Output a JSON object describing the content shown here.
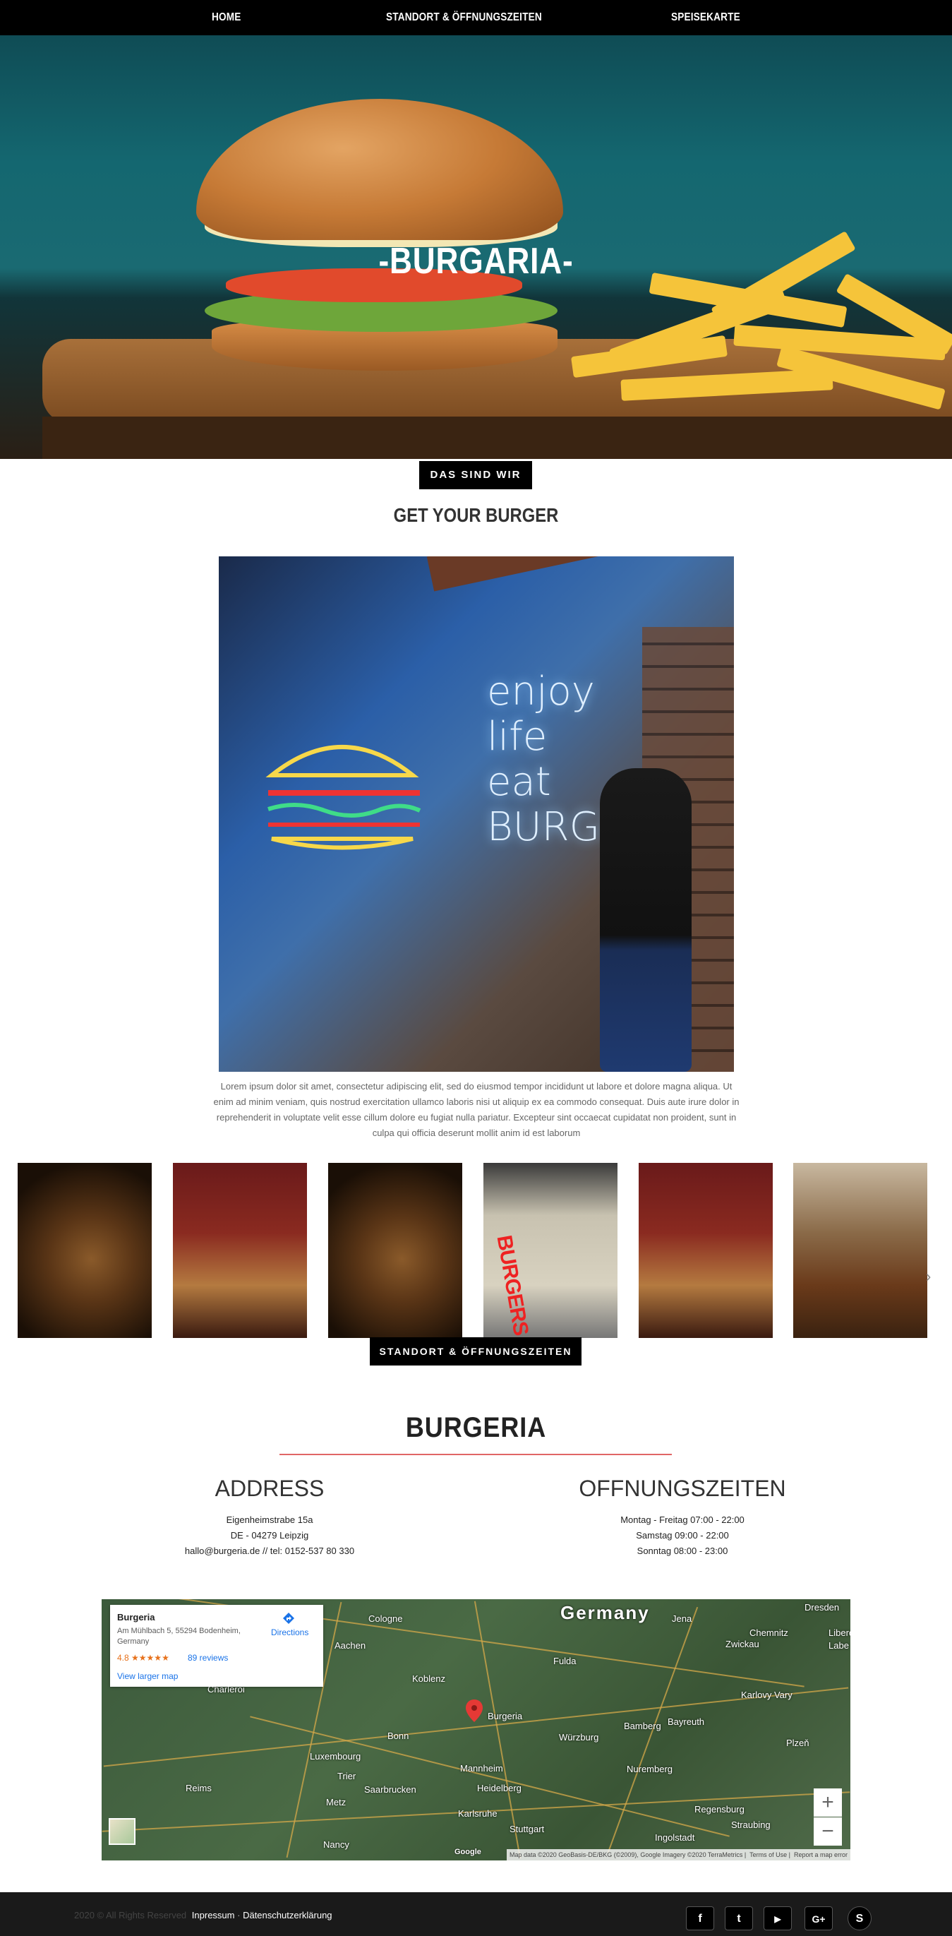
{
  "nav": {
    "home": "HOME",
    "standort": "STANDORT & ÖFFNUNGSZEITEN",
    "speisekarte": "SPEISEKARTE"
  },
  "hero": {
    "title": "-BURGARIA-"
  },
  "about": {
    "badge": "DAS SIND WIR",
    "heading": "GET YOUR BURGER",
    "neon_lines": [
      "enjoy",
      "life",
      "eat",
      "BURGER"
    ],
    "text": "Lorem ipsum dolor sit amet, consectetur adipiscing elit, sed do eiusmod tempor incididunt ut labore et dolore magna aliqua. Ut enim ad minim veniam, quis nostrud exercitation ullamco laboris nisi ut aliquip ex ea commodo consequat. Duis aute irure dolor in reprehenderit in voluptate velit esse cillum dolore eu fugiat nulla pariatur. Excepteur sint occaecat cupidatat non proident, sunt in culpa qui officia deserunt mollit anim id est laborum"
  },
  "gallery": {
    "sign_text": "BURGERS",
    "next_icon": "›"
  },
  "location": {
    "badge": "STANDORT & ÖFFNUNGSZEITEN",
    "title": "BURGERIA",
    "address": {
      "title": "ADDRESS",
      "line1": "Eigenheimstrabe 15a",
      "line2": "DE - 04279 Leipzig",
      "line3": "hallo@burgeria.de // tel: 0152-537 80 330"
    },
    "hours": {
      "title": "OFFNUNGSZEITEN",
      "line1": "Montag - Freitag 07:00 - 22:00",
      "line2": "Samstag 09:00 - 22:00",
      "line3": "Sonntag 08:00 - 23:00"
    }
  },
  "map": {
    "country_label": "Germany",
    "card": {
      "name": "Burgeria",
      "address": "Am Mühlbach 5, 55294 Bodenheim, Germany",
      "rating": "4.8",
      "stars": "★★★★★",
      "reviews": "89 reviews",
      "directions": "Directions",
      "larger_map": "View larger map"
    },
    "cities": [
      "Cologne",
      "Aachen",
      "Koblenz",
      "Bonn",
      "Luxembourg",
      "Trier",
      "Reims",
      "Metz",
      "Nancy",
      "Saarbrucken",
      "Karlsruhe",
      "Stuttgart",
      "Mannheim",
      "Heidelberg",
      "Burgeria",
      "Würzburg",
      "Nuremberg",
      "Bamberg",
      "Bayreuth",
      "Regensburg",
      "Ingolstadt",
      "Straubing",
      "Fulda",
      "Jena",
      "Dresden",
      "Chemnitz",
      "Zwickau",
      "Karlovy Vary",
      "Plzeň",
      "Charleroi",
      "Liberec",
      "Labe"
    ],
    "zoom_in": "+",
    "zoom_out": "−",
    "attribution": "Map data ©2020 GeoBasis-DE/BKG (©2009), Google Imagery ©2020 TerraMetrics",
    "terms": "Terms of Use",
    "report": "Report a map error",
    "logo": "Google"
  },
  "footer": {
    "copyright": "2020 © All Rights Reserved",
    "impressum": "Inpressum",
    "datenschutz": "Dätenschutzerklärung",
    "social": [
      {
        "icon": "facebook-icon",
        "glyph": "f"
      },
      {
        "icon": "twitter-icon",
        "glyph": "t"
      },
      {
        "icon": "youtube-icon",
        "glyph": "▶"
      },
      {
        "icon": "google-plus-icon",
        "glyph": "G+"
      },
      {
        "icon": "skype-icon",
        "glyph": "S"
      }
    ]
  }
}
